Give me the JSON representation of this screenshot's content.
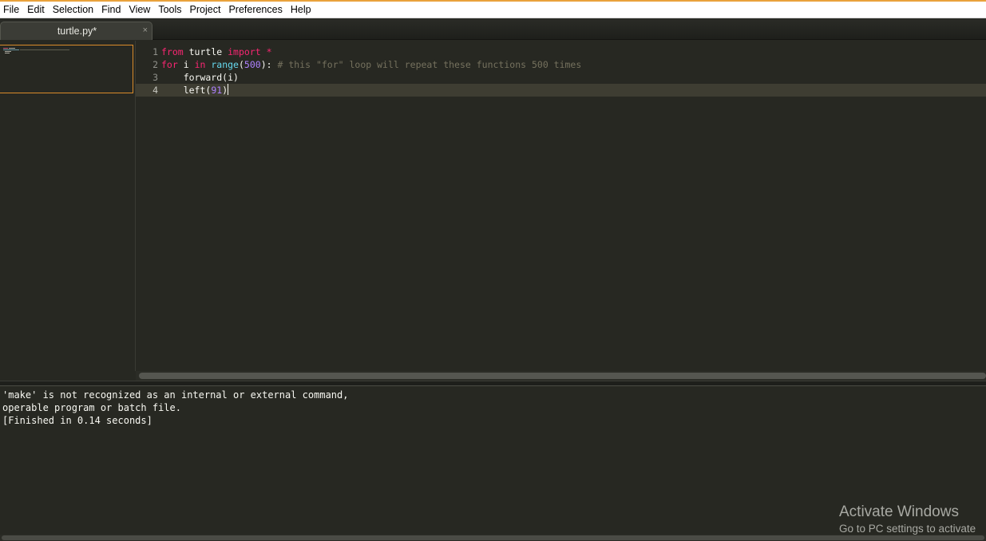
{
  "menu": [
    "File",
    "Edit",
    "Selection",
    "Find",
    "View",
    "Tools",
    "Project",
    "Preferences",
    "Help"
  ],
  "tab": {
    "title": "turtle.py*",
    "close": "×"
  },
  "gutter": [
    "1",
    "2",
    "3",
    "4"
  ],
  "code": {
    "line1": {
      "kw_from": "from",
      "module": " turtle ",
      "kw_import": "import",
      "star": " *"
    },
    "line2": {
      "kw_for": "for",
      "var": " i ",
      "kw_in": "in",
      "sp": " ",
      "fn": "range",
      "open": "(",
      "num": "500",
      "close": "): ",
      "comment": "# this \"for\" loop will repeat these functions 500 times"
    },
    "line3": {
      "text": "    forward(i)"
    },
    "line4": {
      "indent": "    left",
      "open": "(",
      "num": "91",
      "close": ")"
    }
  },
  "console": [
    "'make' is not recognized as an internal or external command,",
    "operable program or batch file.",
    "[Finished in 0.14 seconds]"
  ],
  "watermark": {
    "title": "Activate Windows",
    "subtitle": "Go to PC settings to activate"
  },
  "colors": {
    "background": "#272822",
    "keyword": "#f92672",
    "function": "#66d9ef",
    "number": "#ae81ff",
    "comment": "#75715e",
    "accent": "#e9a23b"
  }
}
